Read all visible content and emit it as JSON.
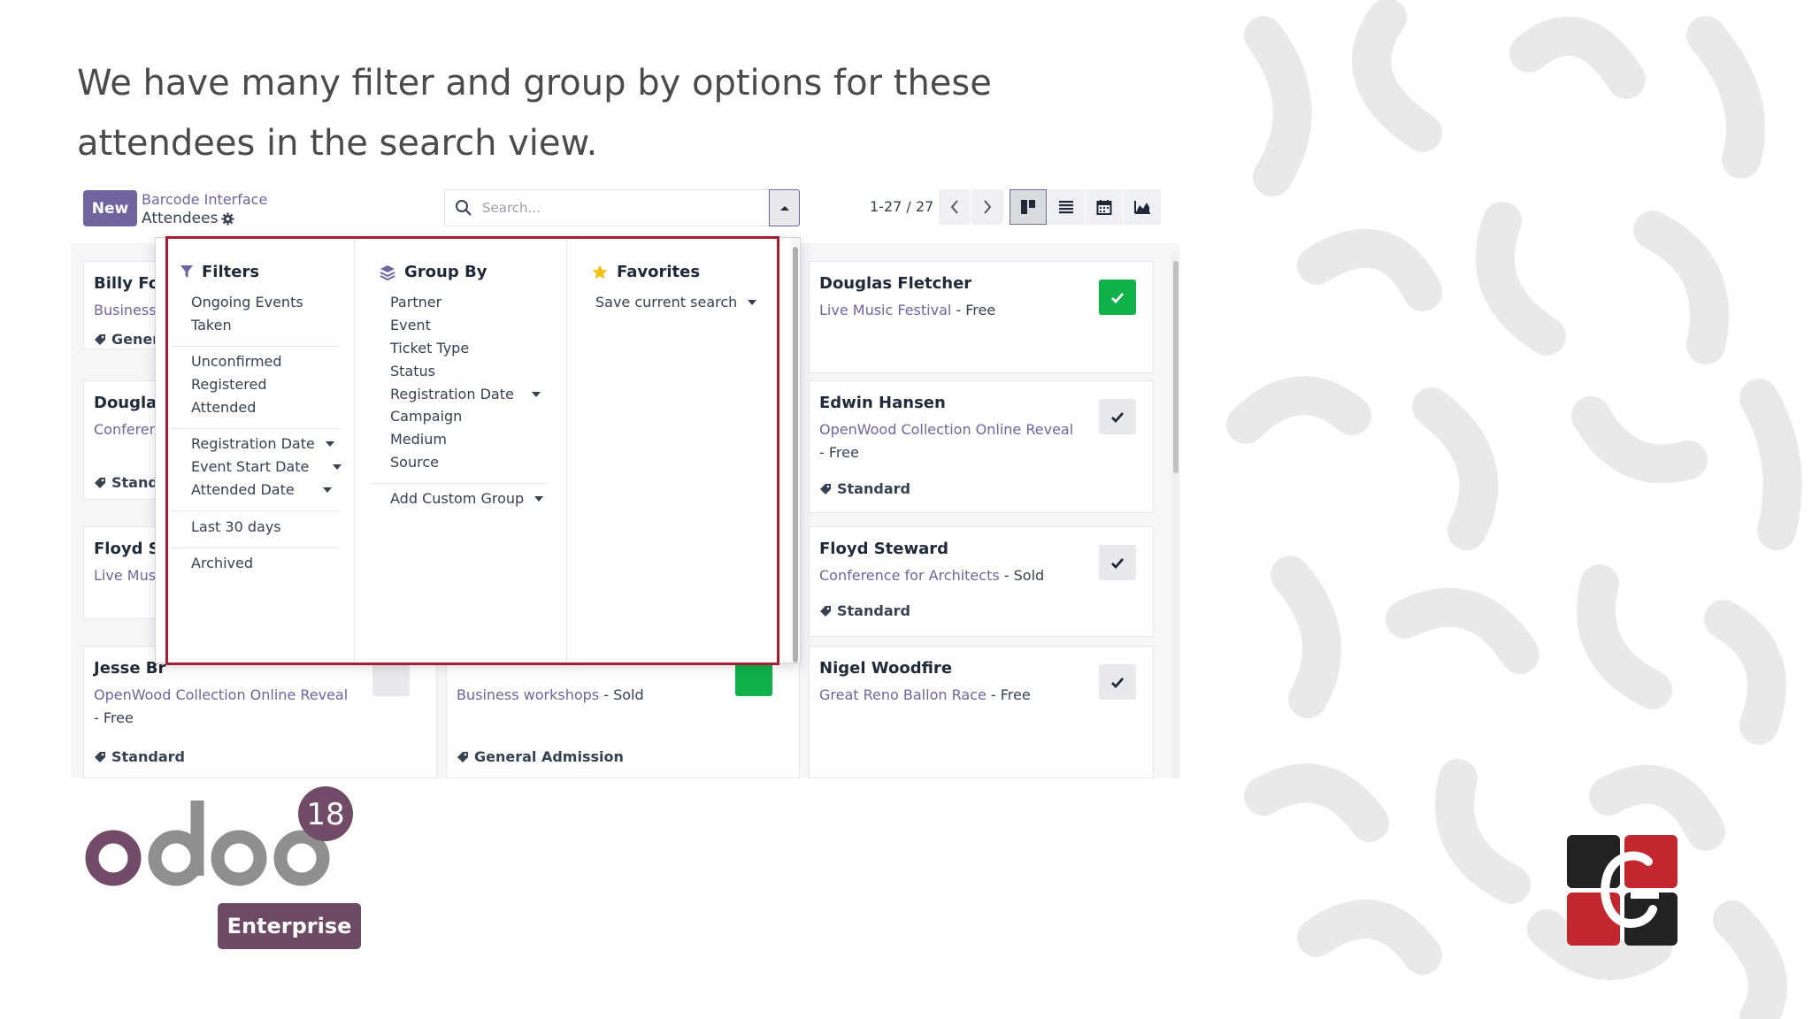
{
  "headline": "We have many filter and group by options for these attendees in the search view.",
  "control_panel": {
    "new_label": "New",
    "breadcrumb_parent": "Barcode Interface",
    "breadcrumb_current": "Attendees",
    "search_placeholder": "Search...",
    "pager": "1-27 / 27"
  },
  "cards": [
    {
      "name": "Billy Fox",
      "event": "Business",
      "tag": "Gener"
    },
    {
      "name": "Douglas",
      "event": "Conferen",
      "tag": "Stand"
    },
    {
      "name": "Floyd St",
      "event": "Live Musi",
      "tag": ""
    },
    {
      "name": "Jesse Br",
      "event": "OpenWood Collection Online Reveal",
      "suffix": "- Free",
      "tag": "Standard"
    },
    {
      "name": "",
      "event": "Business workshops",
      "suffix": " - Sold",
      "tag": "General Admission"
    },
    {
      "name": "Douglas Fletcher",
      "event": "Live Music Festival",
      "suffix": " - Free",
      "tag": "",
      "attended": true
    },
    {
      "name": "Edwin Hansen",
      "event": "OpenWood Collection Online Reveal",
      "suffix": "- Free",
      "tag": "Standard",
      "attended": false
    },
    {
      "name": "Floyd Steward",
      "event": "Conference for Architects",
      "suffix": " - Sold",
      "tag": "Standard",
      "attended": false
    },
    {
      "name": "Nigel Woodfire",
      "event": "Great Reno Ballon Race",
      "suffix": " - Free",
      "tag": "",
      "attended": false
    }
  ],
  "filters": {
    "title": "Filters",
    "items": [
      "Ongoing Events",
      "Taken",
      "Unconfirmed",
      "Registered",
      "Attended",
      "Registration Date",
      "Event Start Date",
      "Attended Date",
      "Last 30 days",
      "Archived"
    ]
  },
  "group_by": {
    "title": "Group By",
    "items": [
      "Partner",
      "Event",
      "Ticket Type",
      "Status",
      "Registration Date",
      "Campaign",
      "Medium",
      "Source",
      "Add Custom Group"
    ]
  },
  "favorites": {
    "title": "Favorites",
    "items": [
      "Save current search"
    ]
  },
  "logo": {
    "wordmark": "odoo",
    "version": "18",
    "edition": "Enterprise"
  },
  "colors": {
    "primary": "#71639e",
    "success": "#10b04b",
    "highlight": "#a71d31",
    "brand_red": "#c1272d",
    "brand_dark": "#222222"
  }
}
